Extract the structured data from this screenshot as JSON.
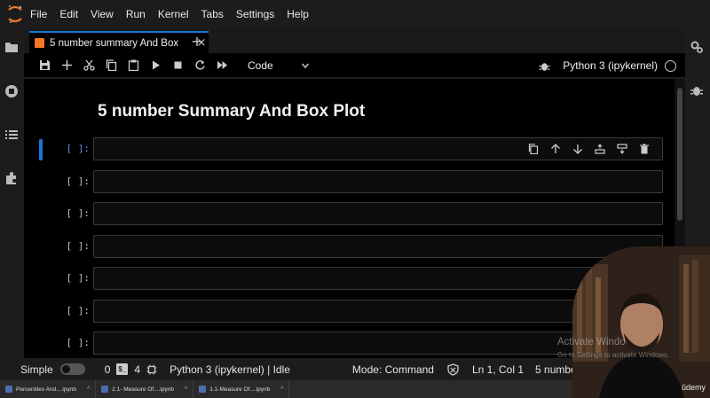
{
  "menu": [
    "File",
    "Edit",
    "View",
    "Run",
    "Kernel",
    "Tabs",
    "Settings",
    "Help"
  ],
  "tab": {
    "label": "5 number summary And Box",
    "close": "×",
    "add": "+"
  },
  "toolbar": {
    "cell_type": "Code",
    "kernel": "Python 3 (ipykernel)"
  },
  "notebook": {
    "heading": "5 number Summary And Box Plot",
    "cells": [
      {
        "prompt": "[ ]:"
      },
      {
        "prompt": "[ ]:"
      },
      {
        "prompt": "[ ]:"
      },
      {
        "prompt": "[ ]:"
      },
      {
        "prompt": "[ ]:"
      },
      {
        "prompt": "[ ]:"
      },
      {
        "prompt": "[ ]:"
      }
    ]
  },
  "status": {
    "mode_toggle": "Simple",
    "count_a": "0",
    "count_b": "4",
    "kernel_status": "Python 3 (ipykernel) | Idle",
    "mode": "Mode: Command",
    "cursor": "Ln 1, Col 1",
    "file": "5 number s"
  },
  "overlay": {
    "activate_title": "Activate Windo",
    "activate_sub": "Go to Settings to activate Windows.",
    "brand": "ûdemy"
  },
  "taskbar": [
    {
      "label": "Percentiles And....ipynb"
    },
    {
      "label": "2.1- Measure Of....ipynb"
    },
    {
      "label": "1.1-Measure Of....ipynb"
    }
  ],
  "colors": {
    "accent": "#1976d2",
    "jupyter_orange": "#f37726",
    "background": "#000000"
  }
}
